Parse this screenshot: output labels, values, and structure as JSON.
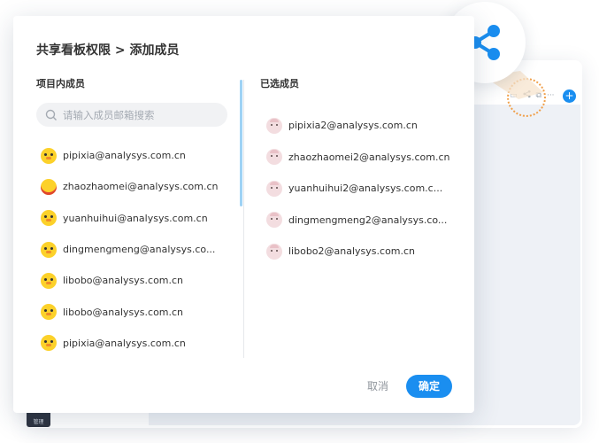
{
  "dialog": {
    "title": "共享看板权限 > 添加成员",
    "left_heading": "项目内成员",
    "right_heading": "已选成员",
    "search_placeholder": "请输入成员邮箱搜索",
    "cancel_label": "取消",
    "ok_label": "确定"
  },
  "project_members": [
    {
      "name": "pipixia@analysys.com.cn",
      "avatar": "duck-icon"
    },
    {
      "name": "zhaozhaomei@analysys.com.cn",
      "avatar": "duck-red-icon"
    },
    {
      "name": "yuanhuihui@analysys.com.cn",
      "avatar": "duck-icon"
    },
    {
      "name": "dingmengmeng@analysys.co...",
      "avatar": "duck-icon"
    },
    {
      "name": "libobo@analysys.com.cn",
      "avatar": "duck-icon"
    },
    {
      "name": "libobo@analysys.com.cn",
      "avatar": "duck-icon"
    },
    {
      "name": "pipixia@analysys.com.cn",
      "avatar": "duck-icon"
    }
  ],
  "selected_members": [
    {
      "name": "pipixia2@analysys.com.cn",
      "avatar": "creature-icon"
    },
    {
      "name": "zhaozhaomei2@analysys.com.cn",
      "avatar": "creature-icon"
    },
    {
      "name": "yuanhuihui2@analysys.com.c...",
      "avatar": "creature-icon"
    },
    {
      "name": "dingmengmeng2@analysys.co...",
      "avatar": "creature-icon"
    },
    {
      "name": "libobo2@analysys.com.cn",
      "avatar": "creature-icon"
    }
  ],
  "background": {
    "side_tab_label": "管理",
    "add_button": "+"
  },
  "colors": {
    "accent": "#1a8ef0",
    "highlight": "#f0a04b"
  }
}
